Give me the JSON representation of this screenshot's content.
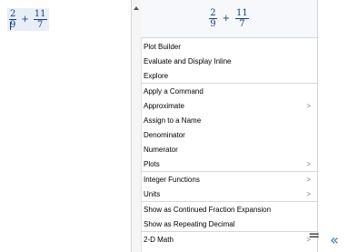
{
  "worksheet": {
    "expression": {
      "frac1": {
        "num": "2",
        "den": "9"
      },
      "op": "+",
      "frac2": {
        "num": "11",
        "den": "7"
      }
    }
  },
  "context_menu": {
    "preview": {
      "frac1": {
        "num": "2",
        "den": "9"
      },
      "op": "+",
      "frac2": {
        "num": "11",
        "den": "7"
      }
    },
    "groups": [
      [
        {
          "label": "Plot Builder",
          "submenu": false
        },
        {
          "label": "Evaluate and Display Inline",
          "submenu": false
        },
        {
          "label": "Explore",
          "submenu": false
        }
      ],
      [
        {
          "label": "Apply a Command",
          "submenu": false
        },
        {
          "label": "Approximate",
          "submenu": true
        },
        {
          "label": "Assign to a Name",
          "submenu": false
        },
        {
          "label": "Denominator",
          "submenu": false
        },
        {
          "label": "Numerator",
          "submenu": false
        },
        {
          "label": "Plots",
          "submenu": true
        }
      ],
      [
        {
          "label": "Integer Functions",
          "submenu": true
        },
        {
          "label": "Units",
          "submenu": true
        }
      ],
      [
        {
          "label": "Show as Continued Fraction Expansion",
          "submenu": false
        },
        {
          "label": "Show as Repeating Decimal",
          "submenu": false
        }
      ],
      [
        {
          "label": "2-D Math",
          "submenu": true
        }
      ]
    ],
    "submenu_glyph": ">"
  },
  "result": {
    "equals": "=",
    "arrow_glyph": "«"
  },
  "colors": {
    "math_blue": "#1c3f7a",
    "arrow_blue": "#3a6ea5"
  }
}
